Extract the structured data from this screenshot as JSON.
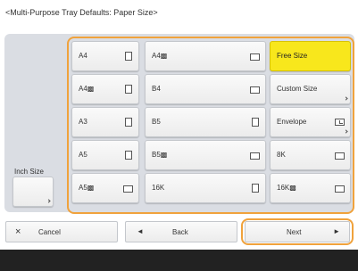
{
  "title": "<Multi-Purpose Tray Defaults: Paper Size>",
  "inch_size_label": "Inch Size",
  "paper_sizes": [
    {
      "label": "A4",
      "icon": "portrait-paper-icon"
    },
    {
      "label": "A4▩",
      "icon": "landscape-paper-icon"
    },
    {
      "label": "Free Size",
      "icon": "",
      "selected": true
    },
    {
      "label": "A4▩",
      "icon": "portrait-paper-icon"
    },
    {
      "label": "B4",
      "icon": "landscape-paper-icon"
    },
    {
      "label": "Custom Size",
      "icon": "",
      "submenu": true
    },
    {
      "label": "A3",
      "icon": "portrait-paper-icon"
    },
    {
      "label": "B5",
      "icon": "portrait-paper-icon"
    },
    {
      "label": "Envelope",
      "icon": "envelope-icon",
      "submenu": true
    },
    {
      "label": "A5",
      "icon": "portrait-paper-icon"
    },
    {
      "label": "B5▩",
      "icon": "landscape-paper-icon"
    },
    {
      "label": "8K",
      "icon": "landscape-paper-icon"
    },
    {
      "label": "A5▩",
      "icon": "landscape-paper-icon"
    },
    {
      "label": "16K",
      "icon": "portrait-paper-icon"
    },
    {
      "label": "16K▩",
      "icon": "landscape-paper-icon"
    }
  ],
  "buttons": {
    "cancel": {
      "label": "Cancel",
      "icon": "close-icon"
    },
    "back": {
      "label": "Back",
      "icon": "left-arrow-icon"
    },
    "next": {
      "label": "Next",
      "icon": "right-arrow-icon"
    }
  },
  "colors": {
    "accent_frame": "#f0a23c",
    "selected": "#f8e71c",
    "footer": "#222222"
  }
}
